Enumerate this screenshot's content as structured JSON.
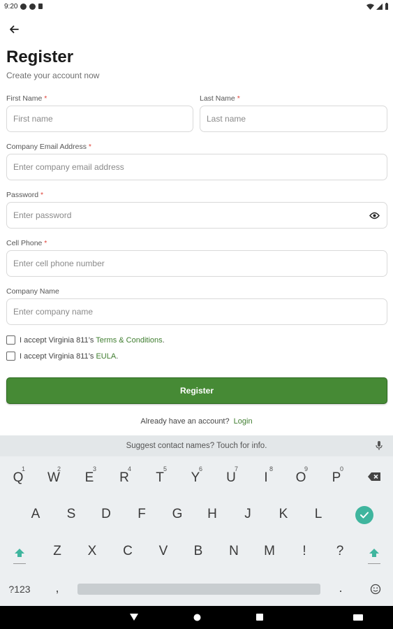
{
  "status_bar": {
    "time": "9:20"
  },
  "page": {
    "title": "Register",
    "subtitle": "Create your account now"
  },
  "form": {
    "first_name": {
      "label": "First Name",
      "required": "*",
      "placeholder": "First name"
    },
    "last_name": {
      "label": "Last Name",
      "required": "*",
      "placeholder": "Last name"
    },
    "email": {
      "label": "Company Email Address",
      "required": "*",
      "placeholder": "Enter company email address"
    },
    "password": {
      "label": "Password",
      "required": "*",
      "placeholder": "Enter password"
    },
    "cell_phone": {
      "label": "Cell Phone",
      "required": "*",
      "placeholder": "Enter cell phone number"
    },
    "company_name": {
      "label": "Company Name",
      "placeholder": "Enter company name"
    },
    "terms": {
      "prefix": "I accept Virginia 811’s ",
      "link": "Terms & Conditions",
      "suffix": "."
    },
    "eula": {
      "prefix": "I accept Virginia 811’s ",
      "link": "EULA",
      "suffix": "."
    },
    "register_button": "Register",
    "login_prompt": "Already have an account?",
    "login_link": "Login"
  },
  "keyboard": {
    "suggestion": "Suggest contact names? Touch for info.",
    "row1": [
      {
        "k": "Q",
        "n": "1"
      },
      {
        "k": "W",
        "n": "2"
      },
      {
        "k": "E",
        "n": "3"
      },
      {
        "k": "R",
        "n": "4"
      },
      {
        "k": "T",
        "n": "5"
      },
      {
        "k": "Y",
        "n": "6"
      },
      {
        "k": "U",
        "n": "7"
      },
      {
        "k": "I",
        "n": "8"
      },
      {
        "k": "O",
        "n": "9"
      },
      {
        "k": "P",
        "n": "0"
      }
    ],
    "row2": [
      "A",
      "S",
      "D",
      "F",
      "G",
      "H",
      "J",
      "K",
      "L"
    ],
    "row3": [
      "Z",
      "X",
      "C",
      "V",
      "B",
      "N",
      "M",
      "!",
      "?"
    ],
    "symbols_key": "?123",
    "comma_key": ",",
    "period_key": ".",
    "accent_color": "#3fb59e"
  },
  "colors": {
    "primary_green": "#468a35",
    "link_green": "#3f7d2f",
    "required_red": "#e0453b"
  }
}
